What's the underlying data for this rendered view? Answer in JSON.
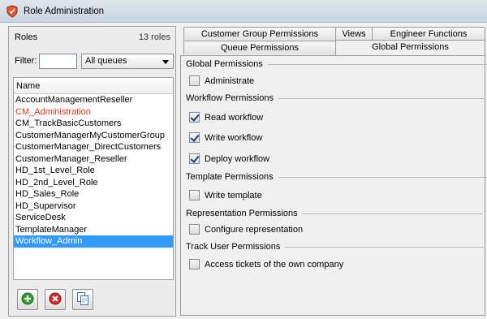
{
  "window": {
    "title": "Role Administration"
  },
  "roles": {
    "title": "Roles",
    "count": "13 roles",
    "filter_label": "Filter:",
    "filter_value": "",
    "queue_select": "All queues",
    "column_header": "Name",
    "items": [
      "AccountManagementReseller",
      "CM_Administration",
      "CM_TrackBasicCustomers",
      "CustomerManagerMyCustomerGroup",
      "CustomerManager_DirectCustomers",
      "CustomerManager_Reseller",
      "HD_1st_Level_Role",
      "HD_2nd_Level_Role",
      "HD_Sales_Role",
      "HD_Supervisor",
      "ServiceDesk",
      "TemplateManager",
      "Workflow_Admin"
    ],
    "highlighted_item": "CM_Administration",
    "selected_item": "Workflow_Admin",
    "highlight_color": "#e8351c",
    "selection_color": "#3399ff"
  },
  "buttons": {
    "add": "add-icon",
    "delete": "delete-icon",
    "copy": "copy-icon"
  },
  "tabs": {
    "row1": [
      "Customer Group Permissions",
      "Views",
      "Engineer Functions"
    ],
    "row2": [
      "Queue Permissions",
      "Global Permissions"
    ],
    "active": "Global Permissions"
  },
  "permissions": {
    "global": {
      "title": "Global Permissions",
      "items": [
        {
          "label": "Administrate",
          "checked": false
        }
      ]
    },
    "workflow": {
      "title": "Workflow Permissions",
      "items": [
        {
          "label": "Read workflow",
          "checked": true
        },
        {
          "label": "Write workflow",
          "checked": true
        },
        {
          "label": "Deploy workflow",
          "checked": true
        }
      ]
    },
    "template": {
      "title": "Template Permissions",
      "items": [
        {
          "label": "Write template",
          "checked": false
        }
      ]
    },
    "representation": {
      "title": "Representation Permissions",
      "items": [
        {
          "label": "Configure representation",
          "checked": false
        }
      ]
    },
    "track_user": {
      "title": "Track User Permissions",
      "items": [
        {
          "label": "Access tickets of the own company",
          "checked": false
        }
      ]
    }
  }
}
